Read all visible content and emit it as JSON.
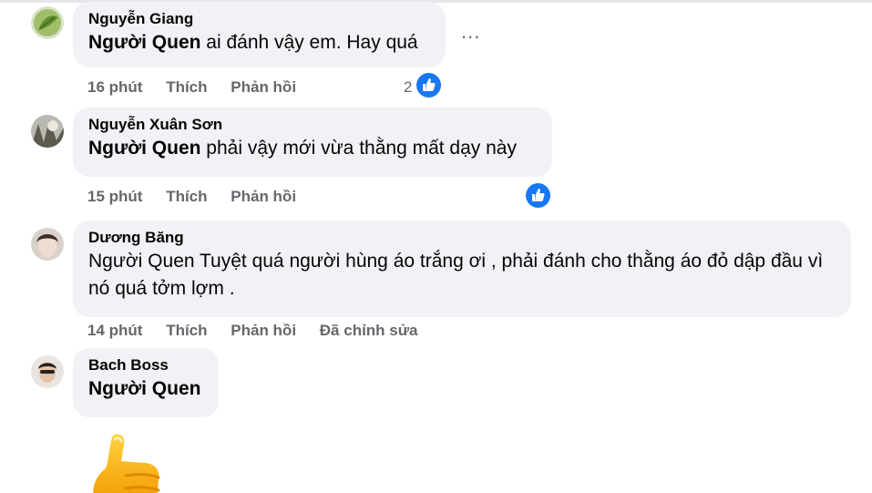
{
  "comments": [
    {
      "author": "Nguyễn Giang",
      "mention": "Người Quen",
      "text": " ai đánh vậy em. Hay quá",
      "time": "16 phút",
      "like_label": "Thích",
      "reply_label": "Phản hồi",
      "reaction_count": "2",
      "reaction_icon": "like-icon"
    },
    {
      "author": "Nguyễn Xuân Sơn",
      "mention": "Người Quen",
      "text": " phải vậy mới vừa thằng mất dạy này",
      "time": "15 phút",
      "like_label": "Thích",
      "reply_label": "Phản hồi",
      "reaction_icon": "like-icon"
    },
    {
      "author": "Dương Băng",
      "text": "Người Quen Tuyệt quá người hùng áo trắng ơi , phải đánh cho thằng áo đỏ dập đầu vì nó quá tởm lợm .",
      "time": "14 phút",
      "like_label": "Thích",
      "reply_label": "Phản hồi",
      "edited_label": "Đã chỉnh sửa"
    },
    {
      "author": "Bach Boss",
      "mention": "Người Quen",
      "sticker": "thumbs-up-sticker"
    }
  ],
  "more_options": "...",
  "colors": {
    "bubble": "#f0f2f5",
    "meta_text": "#65676b",
    "like_blue": "#1877f2",
    "sticker_yellow": "#f7b500"
  }
}
